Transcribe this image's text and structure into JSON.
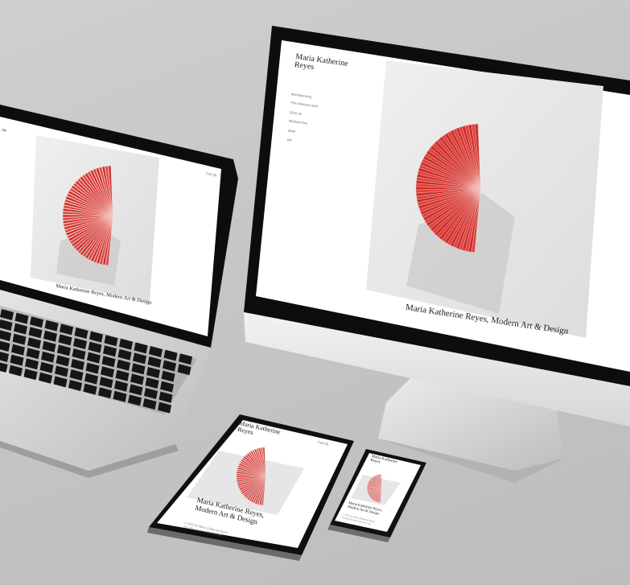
{
  "monitor": {
    "site_title_line1": "Maria Katherine",
    "site_title_line2": "Reyes",
    "nav_items": [
      "Manufacturing",
      "The Unknown work",
      "2016-19",
      "Medium Pots",
      "Book",
      "Bio"
    ],
    "caption": "Maria Katherine Reyes, Modern Art & Design"
  },
  "laptop": {
    "nav_fragment": "ine",
    "corner_link": "Cart (0)",
    "caption": "Maria Katherine Reyes, Modern Art & Design"
  },
  "tablet": {
    "site_title_line1": "Maria Katherine",
    "site_title_line2": "Reyes",
    "cart": "Cart (0)",
    "heading_line1": "Maria Katherine Reyes,",
    "heading_line2": "Modern Art & Design",
    "footer_line1": "© 2025 by Maria Katherine Reyes",
    "footer_line2": "Proudly created with Wix.com"
  },
  "phone": {
    "site_title_line1": "Maria Katherine",
    "site_title_line2": "Reyes",
    "heading_line1": "Maria Katherine Reyes,",
    "heading_line2": "Modern Art & Design",
    "footer_line1": "© 2025 by Maria Katherine Reyes",
    "footer_line2": "Proudly created with Wix.com"
  },
  "colors": {
    "background": "#c6c6c6",
    "device_black": "#0d0d0d",
    "aluminum": "#d9d9d9",
    "artwork_red": "#e0403c"
  }
}
